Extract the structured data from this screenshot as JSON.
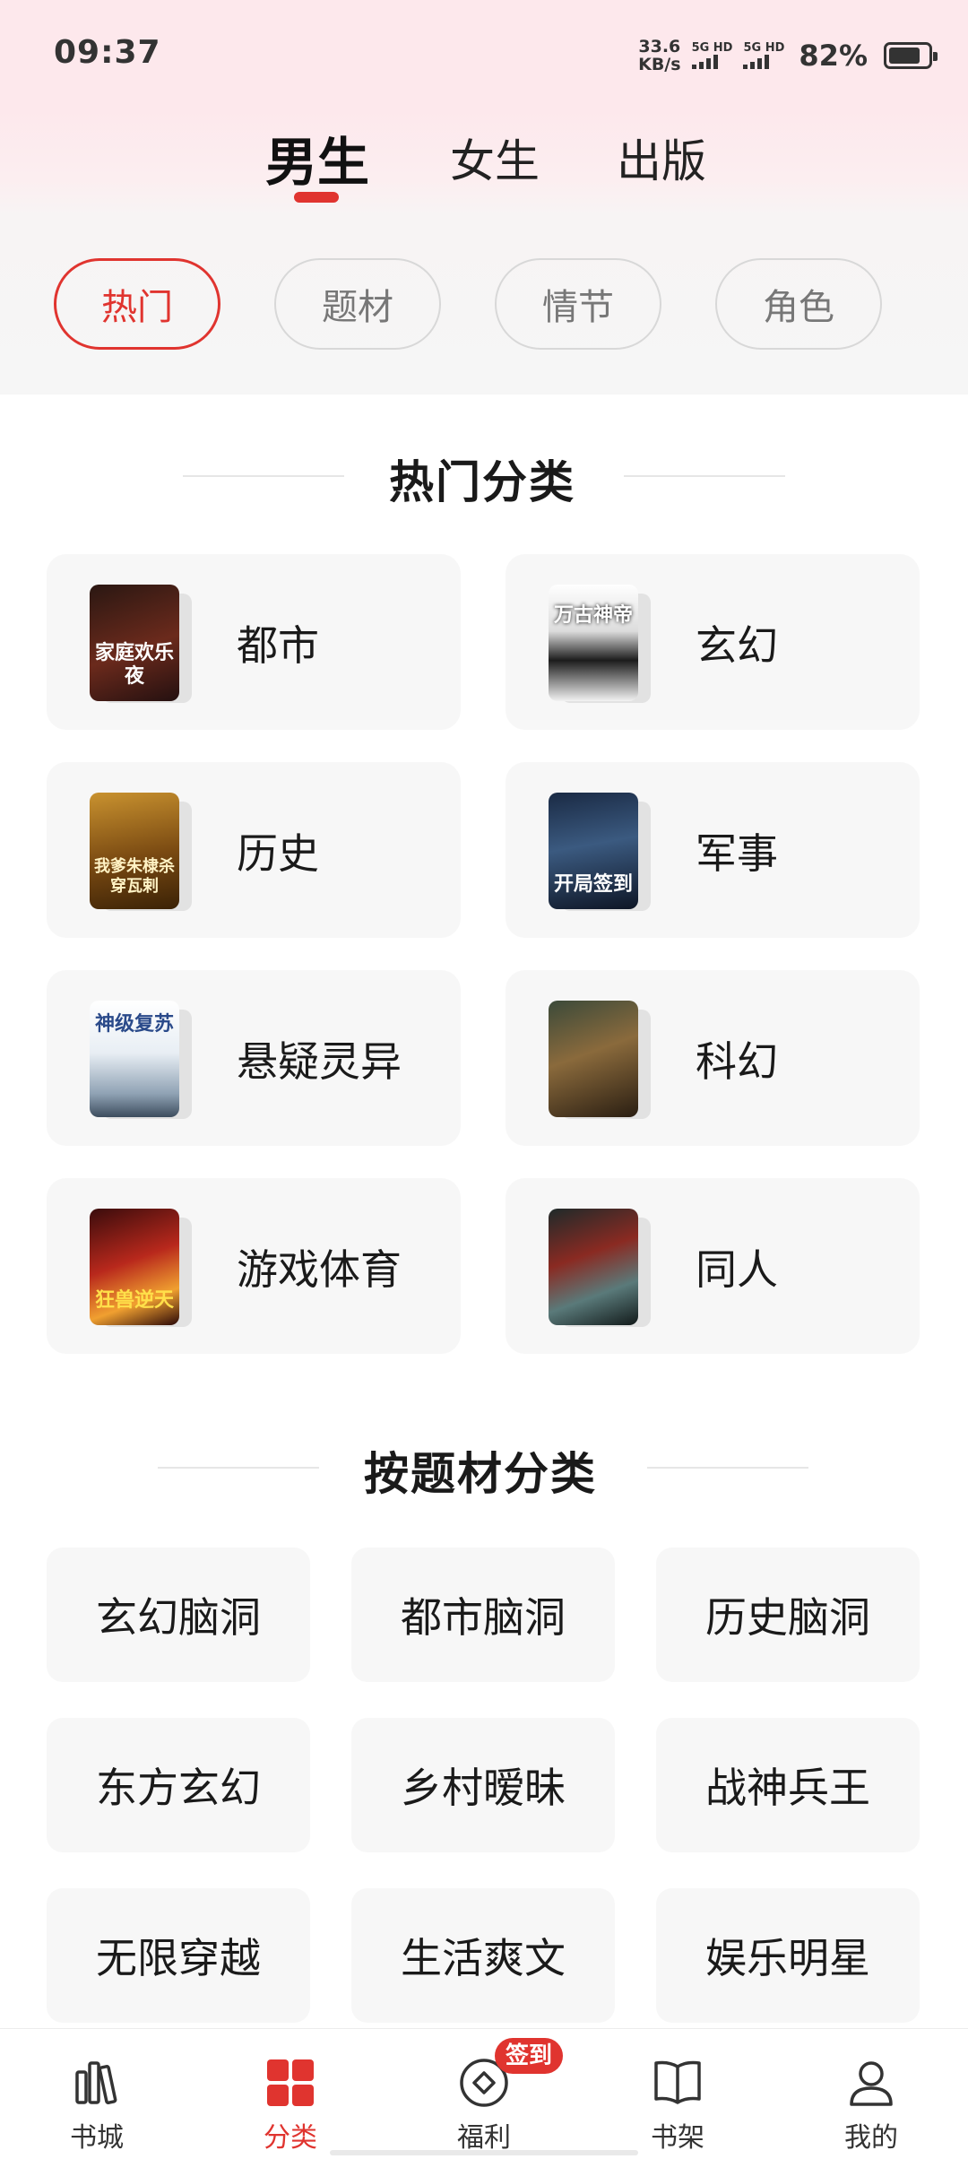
{
  "status_bar": {
    "time": "09:37",
    "net_speed_value": "33.6",
    "net_speed_unit": "KB/s",
    "sim1": "5G HD",
    "sim2": "5G HD",
    "battery": "82%",
    "battery_level": 0.82
  },
  "gender_tabs": [
    {
      "label": "男生",
      "active": true
    },
    {
      "label": "女生",
      "active": false
    },
    {
      "label": "出版",
      "active": false
    }
  ],
  "filters": [
    {
      "label": "热门",
      "active": true
    },
    {
      "label": "题材",
      "active": false
    },
    {
      "label": "情节",
      "active": false
    },
    {
      "label": "角色",
      "active": false
    }
  ],
  "hot_section": {
    "title": "热门分类",
    "items": [
      {
        "label": "都市",
        "cover_title": "家庭欢乐夜"
      },
      {
        "label": "玄幻",
        "cover_title": "万古神帝"
      },
      {
        "label": "历史",
        "cover_title": "我爹朱棣杀穿瓦剌"
      },
      {
        "label": "军事",
        "cover_title": "开局签到"
      },
      {
        "label": "悬疑灵异",
        "cover_title": "神级复苏"
      },
      {
        "label": "科幻",
        "cover_title": ""
      },
      {
        "label": "游戏体育",
        "cover_title": "狂兽逆天"
      },
      {
        "label": "同人",
        "cover_title": ""
      }
    ]
  },
  "topic_section": {
    "title": "按题材分类",
    "items": [
      "玄幻脑洞",
      "都市脑洞",
      "历史脑洞",
      "东方玄幻",
      "乡村暧昧",
      "战神兵王",
      "无限穿越",
      "生活爽文",
      "娱乐明星"
    ]
  },
  "bottom_nav": [
    {
      "label": "书城",
      "icon": "bookstore-icon",
      "active": false
    },
    {
      "label": "分类",
      "icon": "category-grid-icon",
      "active": true
    },
    {
      "label": "福利",
      "icon": "welfare-icon",
      "active": false,
      "badge": "签到"
    },
    {
      "label": "书架",
      "icon": "bookshelf-icon",
      "active": false
    },
    {
      "label": "我的",
      "icon": "profile-icon",
      "active": false
    }
  ],
  "colors": {
    "accent": "#e0342f",
    "card_bg": "#f7f7f7"
  }
}
